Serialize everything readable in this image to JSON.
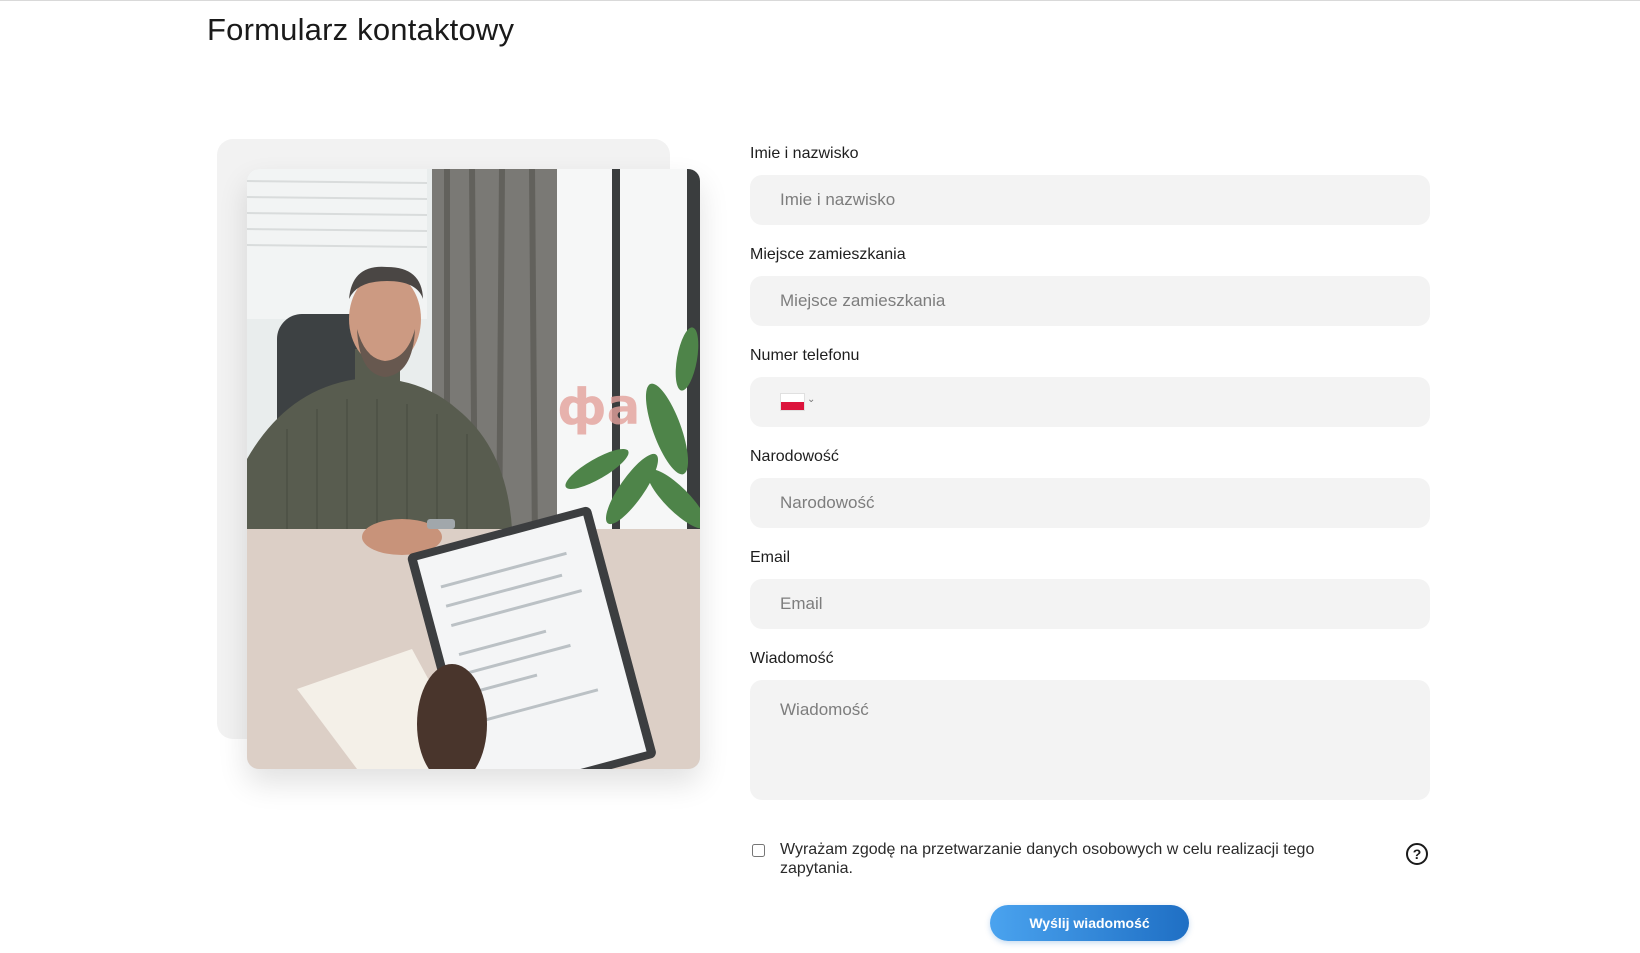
{
  "page": {
    "title": "Formularz kontaktowy"
  },
  "photo": {
    "description_icon": "job-interview-photo"
  },
  "form": {
    "name": {
      "label": "Imie i nazwisko",
      "placeholder": "Imie i nazwisko",
      "value": ""
    },
    "residence": {
      "label": "Miejsce zamieszkania",
      "placeholder": "Miejsce zamieszkania",
      "value": ""
    },
    "phone": {
      "label": "Numer telefonu",
      "country_flag_icon": "poland-flag-icon",
      "value": ""
    },
    "nationality": {
      "label": "Narodowość",
      "placeholder": "Narodowość",
      "value": ""
    },
    "email": {
      "label": "Email",
      "placeholder": "Email",
      "value": ""
    },
    "message": {
      "label": "Wiadomość",
      "placeholder": "Wiadomość",
      "value": ""
    },
    "consent": {
      "text": "Wyrażam zgodę na przetwarzanie danych osobowych w celu realizacji tego zapytania.",
      "checked": false,
      "help_icon": "question-circle-icon",
      "help_glyph": "?"
    },
    "submit_label": "Wyślij wiadomość"
  },
  "colors": {
    "button_gradient_start": "#4aa3ef",
    "button_gradient_end": "#1f6fc4",
    "input_background": "#f3f3f3",
    "flag_red": "#dc143c"
  }
}
